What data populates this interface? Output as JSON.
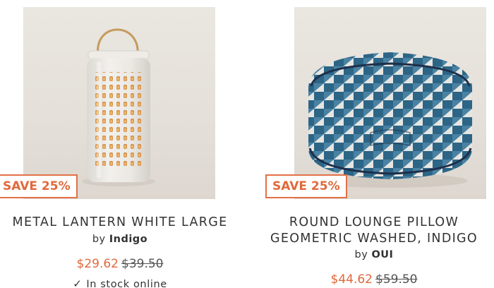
{
  "products": [
    {
      "badge": "SAVE 25%",
      "title": "METAL LANTERN WHITE LARGE",
      "by_label": "by",
      "brand": "Indigo",
      "sale_price": "$29.62",
      "original_price": "$39.50",
      "stock_text": "In stock online",
      "stock_icon": "check-icon",
      "image": "lantern-image"
    },
    {
      "badge": "SAVE 25%",
      "title_line1": "ROUND LOUNGE PILLOW",
      "title_line2": "GEOMETRIC WASHED, INDIGO",
      "by_label": "by",
      "brand": "OUI",
      "sale_price": "$44.62",
      "original_price": "$59.50",
      "image": "pouf-image"
    }
  ],
  "colors": {
    "accent": "#e0693b",
    "text": "#333333",
    "image_bg": "#e5e0da",
    "pouf_blue": "#2e6a8c"
  }
}
